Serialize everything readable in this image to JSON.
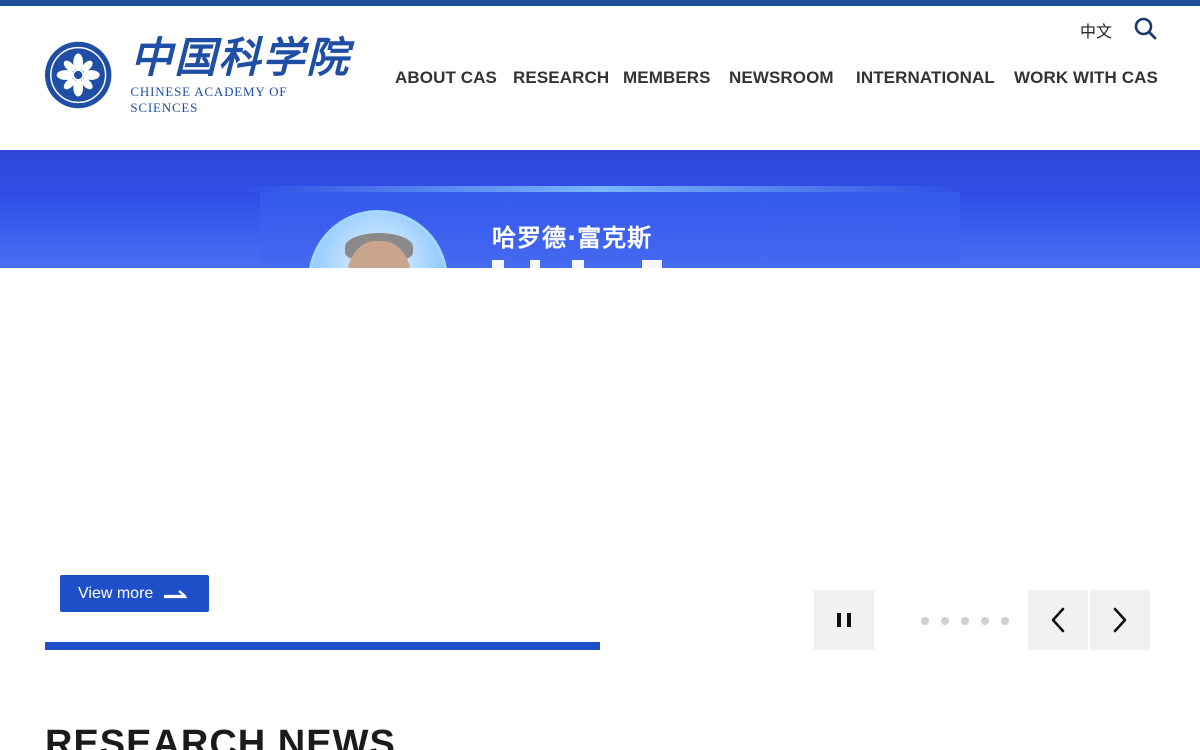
{
  "header": {
    "logo": {
      "name_cn": "中国科学院",
      "name_en": "CHINESE ACADEMY OF SCIENCES",
      "emblem_text": "CHINESE ACADEMY OF SCIENCES"
    },
    "language_link": "中文",
    "search_icon": "search-icon",
    "nav": [
      "ABOUT CAS",
      "RESEARCH",
      "MEMBERS",
      "NEWSROOM",
      "INTERNATIONAL",
      "WORK WITH CAS"
    ]
  },
  "hero": {
    "name_cn": "哈罗德·富克斯"
  },
  "carousel": {
    "view_more_label": "View more",
    "dot_count": 5,
    "pause_icon": "pause-icon",
    "prev_icon": "chevron-left-icon",
    "next_icon": "chevron-right-icon"
  },
  "sections": {
    "research_news_title": "RESEARCH NEWS"
  },
  "colors": {
    "brand_blue": "#1e4fc8",
    "top_bar": "#1d4f9c",
    "logo_blue": "#1f4fa5",
    "control_bg": "#f1f1f1",
    "dot_inactive": "#cfcfcf"
  }
}
